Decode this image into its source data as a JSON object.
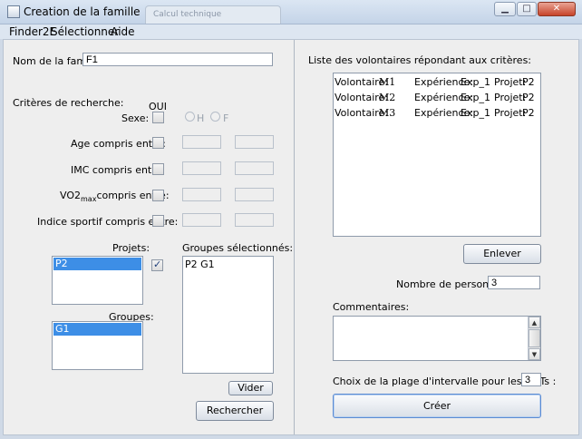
{
  "window": {
    "title": "Creation de la famille",
    "background_tab": "Calcul technique",
    "minimize_glyph": "▁",
    "maximize_glyph": "□",
    "close_glyph": "✕"
  },
  "menu": [
    "Finder2E",
    "Sélectionner",
    "Aide"
  ],
  "left": {
    "family_name_label": "Nom de la famille:",
    "family_name_value": "F1",
    "criteria_label": "Critères de recherche:",
    "oui_label": "OUI",
    "sexe_label": "Sexe:",
    "radio_h": "H",
    "radio_f": "F",
    "age_label": "Age compris entre:",
    "imc_label": "IMC compris entre:",
    "vo2_label_a": "VO2",
    "vo2_label_sub": "max",
    "vo2_label_b": "compris entre:",
    "sport_label": "Indice sportif compris entre:",
    "projets_label": "Projets:",
    "projets_items": [
      "P2"
    ],
    "groupes_label": "Groupes:",
    "groupes_items": [
      "G1"
    ],
    "selected_groups_label": "Groupes sélectionnés:",
    "selected_groups_items": [
      "P2 G1"
    ],
    "vider_button": "Vider",
    "rechercher_button": "Rechercher"
  },
  "right": {
    "volunteers_label": "Liste des volontaires répondant aux critères:",
    "volunteers": [
      {
        "label": "Volontaire:",
        "id": "M1",
        "exp_label": "Expérience:",
        "exp": "Exp_1",
        "proj_label": "Projet:",
        "proj": "P2"
      },
      {
        "label": "Volontaire:",
        "id": "M2",
        "exp_label": "Expérience:",
        "exp": "Exp_1",
        "proj_label": "Projet:",
        "proj": "P2"
      },
      {
        "label": "Volontaire:",
        "id": "M3",
        "exp_label": "Expérience:",
        "exp": "Exp_1",
        "proj_label": "Projet:",
        "proj": "P2"
      }
    ],
    "enlever_button": "Enlever",
    "count_label": "Nombre de personnes:",
    "count_value": "3",
    "comments_label": "Commentaires:",
    "comments_value": "",
    "interval_label": "Choix de la plage d'intervalle pour les METs :",
    "interval_value": "3",
    "creer_button": "Créer"
  }
}
